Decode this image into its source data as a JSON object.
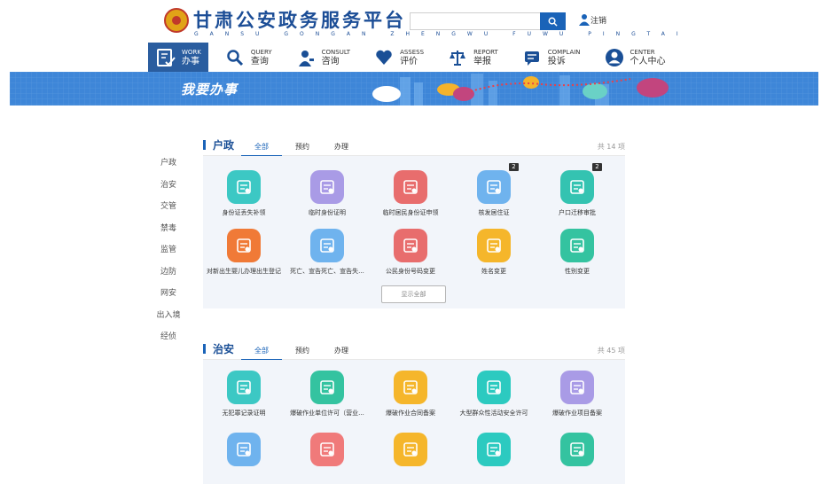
{
  "header": {
    "title": "甘肃公安政务服务平台",
    "subtitle": "GANSU GONGAN ZHENGWU FUWU PINGTAI",
    "search_placeholder": "",
    "login_label": "注销"
  },
  "nav": [
    {
      "en": "WORK",
      "cn": "办事",
      "icon": "work-icon",
      "active": true
    },
    {
      "en": "QUERY",
      "cn": "查询",
      "icon": "search-icon",
      "active": false
    },
    {
      "en": "CONSULT",
      "cn": "咨询",
      "icon": "consult-icon",
      "active": false
    },
    {
      "en": "ASSESS",
      "cn": "评价",
      "icon": "heart-icon",
      "active": false
    },
    {
      "en": "REPORT",
      "cn": "举报",
      "icon": "scale-icon",
      "active": false
    },
    {
      "en": "COMPLAIN",
      "cn": "投诉",
      "icon": "complain-icon",
      "active": false
    },
    {
      "en": "CENTER",
      "cn": "个人中心",
      "icon": "user-icon",
      "active": false
    }
  ],
  "banner": {
    "title": "我要办事"
  },
  "sidebar": [
    "户政",
    "治安",
    "交管",
    "禁毒",
    "监管",
    "边防",
    "网安",
    "出入境",
    "经侦"
  ],
  "sections": [
    {
      "title": "户政",
      "tabs": [
        "全部",
        "预约",
        "办理"
      ],
      "count": "共 14 项",
      "more_label": "显示全部",
      "items": [
        {
          "label": "身份证丢失补领",
          "color": "#3cc8c4",
          "icon": "id-card-icon",
          "badge": ""
        },
        {
          "label": "临时身份证明",
          "color": "#a99be6",
          "icon": "certificate-icon",
          "badge": ""
        },
        {
          "label": "临时居民身份证申领",
          "color": "#e86d6d",
          "icon": "id-card-icon",
          "badge": ""
        },
        {
          "label": "核发居住证",
          "color": "#6fb3ee",
          "icon": "residence-card-icon",
          "badge": "2"
        },
        {
          "label": "户口迁移审批",
          "color": "#34c3b1",
          "icon": "transfer-icon",
          "badge": "2"
        },
        {
          "label": "对新出生婴儿办理出生登记",
          "color": "#f07a37",
          "icon": "register-icon",
          "badge": ""
        },
        {
          "label": "死亡、宣告死亡、宣告失...",
          "color": "#6fb3ee",
          "icon": "document-icon",
          "badge": ""
        },
        {
          "label": "公民身份号码变更",
          "color": "#e86d6d",
          "icon": "change-icon",
          "badge": ""
        },
        {
          "label": "姓名变更",
          "color": "#f5b62b",
          "icon": "change-icon",
          "badge": ""
        },
        {
          "label": "性别变更",
          "color": "#34c3a0",
          "icon": "change-icon",
          "badge": ""
        }
      ]
    },
    {
      "title": "治安",
      "tabs": [
        "全部",
        "预约",
        "办理"
      ],
      "count": "共 45 项",
      "more_label": "",
      "items": [
        {
          "label": "无犯罪记录证明",
          "color": "#3cc8c4",
          "icon": "certificate-icon",
          "badge": ""
        },
        {
          "label": "爆破作业单位许可（营业...",
          "color": "#34c3a0",
          "icon": "license-icon",
          "badge": ""
        },
        {
          "label": "爆破作业合同备案",
          "color": "#f5b62b",
          "icon": "contract-icon",
          "badge": ""
        },
        {
          "label": "大型群众性活动安全许可",
          "color": "#2ccac0",
          "icon": "crowd-icon",
          "badge": ""
        },
        {
          "label": "爆破作业项目备案",
          "color": "#a99be6",
          "icon": "project-icon",
          "badge": ""
        },
        {
          "label": "",
          "color": "#6fb3ee",
          "icon": "user-document-icon",
          "badge": ""
        },
        {
          "label": "",
          "color": "#f07a7a",
          "icon": "radiation-icon",
          "badge": ""
        },
        {
          "label": "",
          "color": "#f5b62b",
          "icon": "edit-document-icon",
          "badge": ""
        },
        {
          "label": "",
          "color": "#2ccac0",
          "icon": "yuan-icon",
          "badge": ""
        },
        {
          "label": "",
          "color": "#34c3a0",
          "icon": "clipboard-icon",
          "badge": ""
        }
      ]
    }
  ]
}
